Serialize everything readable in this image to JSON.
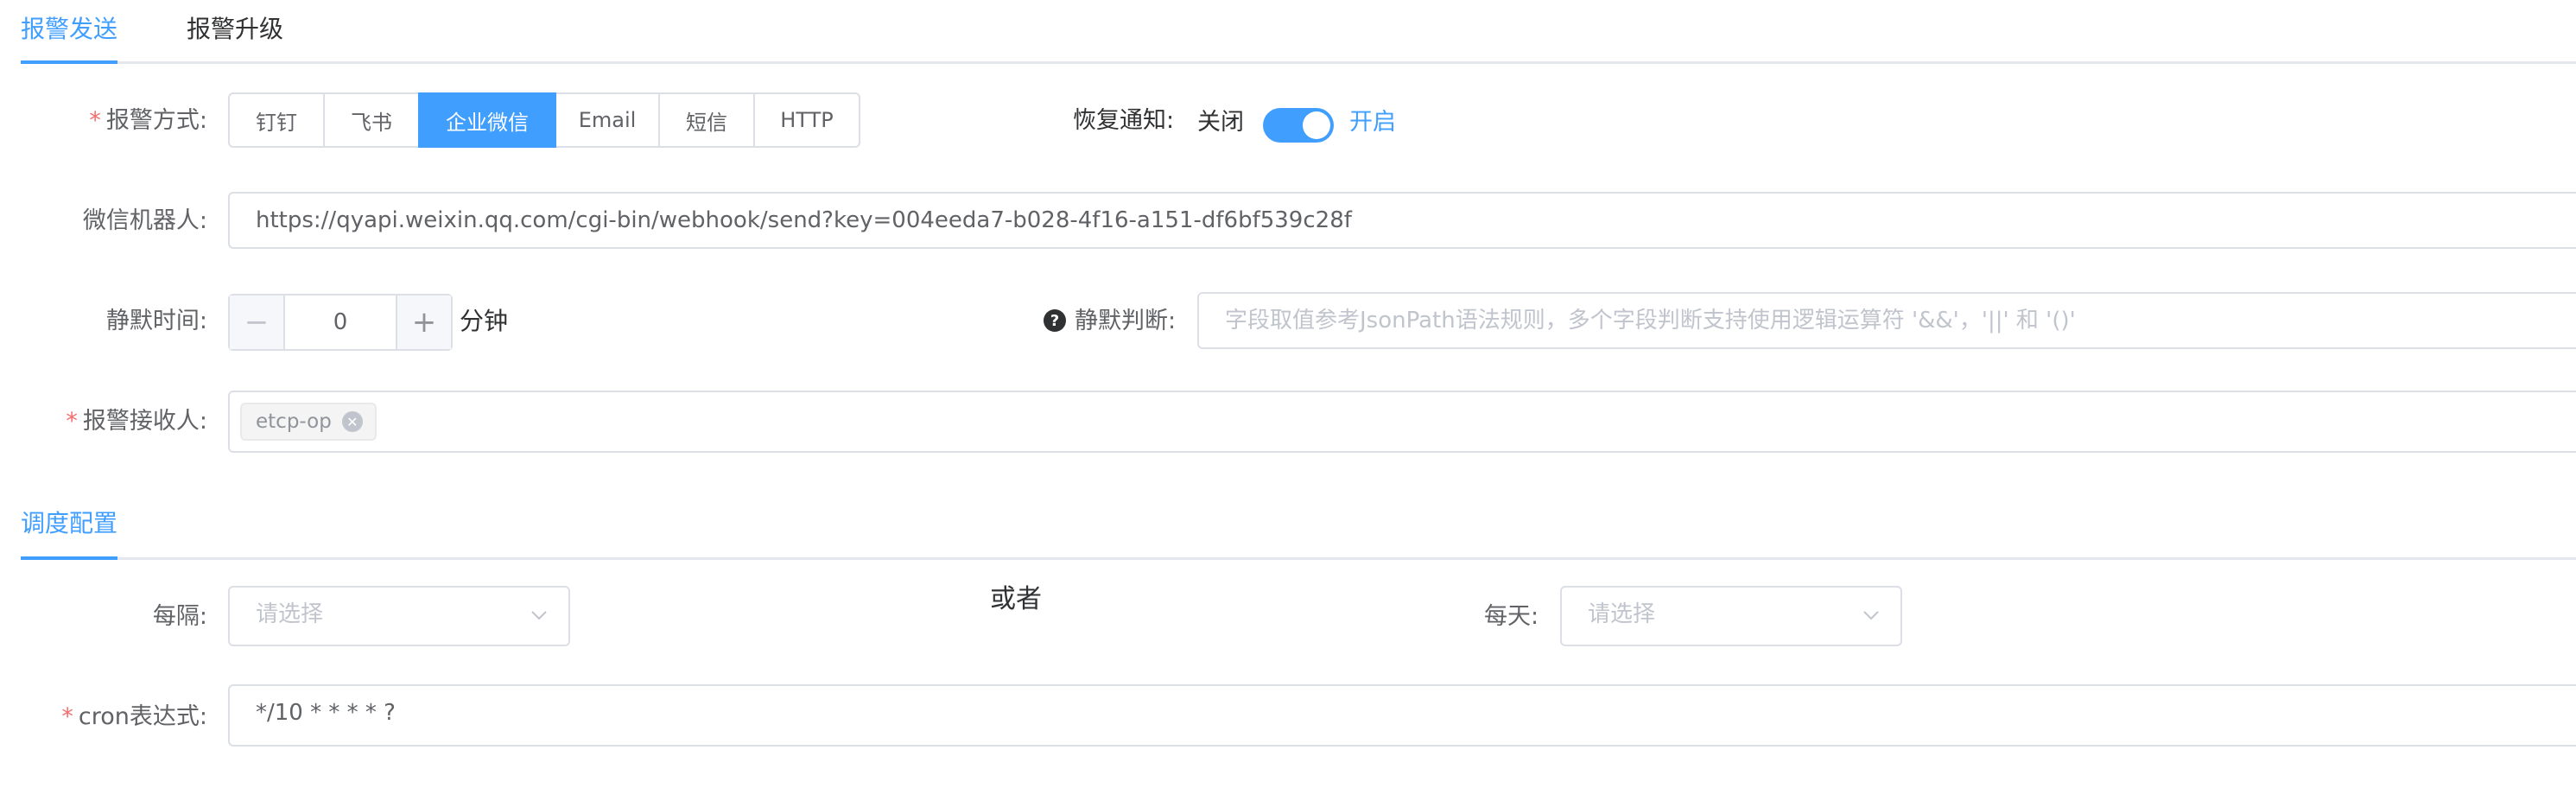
{
  "tabs_top": [
    {
      "label": "报警发送",
      "active": true
    },
    {
      "label": "报警升级",
      "active": false
    }
  ],
  "alert_method": {
    "label": "报警方式:",
    "required": true,
    "options": [
      "钉钉",
      "飞书",
      "企业微信",
      "Email",
      "短信",
      "HTTP"
    ],
    "selected": "企业微信"
  },
  "recovery": {
    "label": "恢复通知:",
    "off_text": "关闭",
    "on_text": "开启",
    "enabled": true
  },
  "webhook": {
    "label": "微信机器人:",
    "value": "https://qyapi.weixin.qq.com/cgi-bin/webhook/send?key=004eeda7-b028-4f16-a151-df6bf539c28f"
  },
  "silence_time": {
    "label": "静默时间:",
    "value": "0",
    "unit": "分钟"
  },
  "silence_judge": {
    "label": "静默判断:",
    "placeholder": "字段取值参考JsonPath语法规则，多个字段判断支持使用逻辑运算符 '&&'，'||' 和 '()'"
  },
  "receivers": {
    "label": "报警接收人:",
    "required": true,
    "tags": [
      "etcp-op"
    ]
  },
  "tabs_schedule": [
    {
      "label": "调度配置",
      "active": true
    }
  ],
  "every": {
    "label": "每隔:",
    "placeholder": "请选择"
  },
  "or_text": "或者",
  "daily": {
    "label": "每天:",
    "placeholder": "请选择"
  },
  "cron": {
    "label": "cron表达式:",
    "required": true,
    "value": "*/10 * * * * ?"
  },
  "colors": {
    "primary": "#409eff",
    "required": "#f56c6c",
    "border": "#dcdfe6"
  }
}
